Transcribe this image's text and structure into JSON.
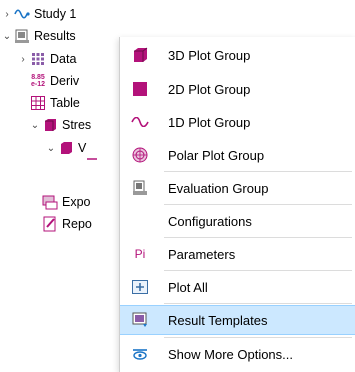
{
  "tree": {
    "study": "Study 1",
    "results": "Results",
    "data": "Data",
    "derived": "Deriv",
    "derived_badge_top": "8.85",
    "derived_badge_bot": "e-12",
    "tables": "Table",
    "stress": "Stres",
    "stress_child": "V",
    "export": "Expo",
    "reports": "Repo"
  },
  "menu": {
    "items": [
      {
        "label": "3D Plot Group",
        "icon": "cube-3d-icon"
      },
      {
        "label": "2D Plot Group",
        "icon": "square-2d-icon"
      },
      {
        "label": "1D Plot Group",
        "icon": "wave-1d-icon"
      },
      {
        "label": "Polar Plot Group",
        "icon": "polar-icon"
      },
      {
        "label": "Evaluation Group",
        "icon": "evaluation-icon"
      },
      {
        "label": "Configurations",
        "icon": ""
      },
      {
        "label": "Parameters",
        "icon": "parameters-icon"
      },
      {
        "label": "Plot All",
        "icon": "plot-all-icon"
      },
      {
        "label": "Result Templates",
        "icon": "result-templates-icon"
      },
      {
        "label": "Show More Options...",
        "icon": "show-more-icon"
      }
    ],
    "parameters_glyph": "Pi"
  },
  "colors": {
    "magenta": "#b3127a",
    "highlight": "#cce8ff",
    "study_blue": "#1a74c6"
  }
}
